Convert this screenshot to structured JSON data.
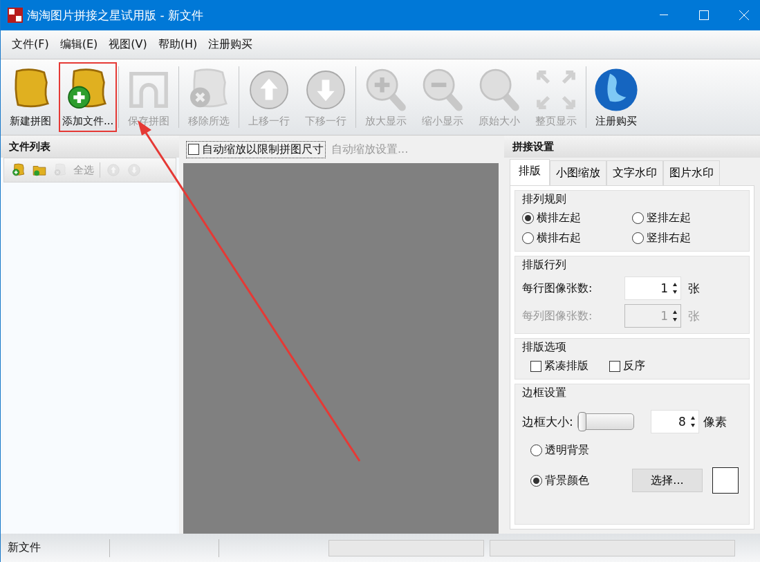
{
  "window": {
    "title": "淘淘图片拼接之星试用版 - 新文件"
  },
  "menu": [
    "文件(F)",
    "编辑(E)",
    "视图(V)",
    "帮助(H)",
    "注册购买"
  ],
  "toolbar_groups": [
    [
      {
        "kind": "new",
        "label": "新建拼图",
        "disabled": false,
        "highlighted": false
      },
      {
        "kind": "add",
        "label": "添加文件...",
        "disabled": false,
        "highlighted": true
      }
    ],
    [
      {
        "kind": "save",
        "label": "保存拼图",
        "disabled": true,
        "highlighted": false
      }
    ],
    [
      {
        "kind": "remove",
        "label": "移除所选",
        "disabled": true,
        "highlighted": false
      }
    ],
    [
      {
        "kind": "up",
        "label": "上移一行",
        "disabled": true,
        "highlighted": false
      },
      {
        "kind": "down",
        "label": "下移一行",
        "disabled": true,
        "highlighted": false
      }
    ],
    [
      {
        "kind": "zoomin",
        "label": "放大显示",
        "disabled": true,
        "highlighted": false
      },
      {
        "kind": "zoomout",
        "label": "缩小显示",
        "disabled": true,
        "highlighted": false
      },
      {
        "kind": "original",
        "label": "原始大小",
        "disabled": true,
        "highlighted": false
      },
      {
        "kind": "fit",
        "label": "整页显示",
        "disabled": true,
        "highlighted": false
      }
    ],
    [
      {
        "kind": "globe",
        "label": "注册购买",
        "disabled": false,
        "highlighted": false
      }
    ]
  ],
  "file_list": {
    "title": "文件列表",
    "tools": [
      {
        "kind": "add",
        "disabled": false
      },
      {
        "kind": "folder",
        "disabled": false
      },
      {
        "kind": "remove",
        "disabled": true
      },
      {
        "kind": "text",
        "label": "全选",
        "disabled": true
      },
      {
        "kind": "separator"
      },
      {
        "kind": "up",
        "disabled": true
      },
      {
        "kind": "down",
        "disabled": true
      }
    ]
  },
  "canvas": {
    "auto_scale": {
      "label": "自动缩放以限制拼图尺寸",
      "checked": false
    },
    "settings_link": "自动缩放设置..."
  },
  "settings": {
    "title": "拼接设置",
    "tabs": [
      {
        "label": "排版",
        "selected": true
      },
      {
        "label": "小图缩放",
        "selected": false
      },
      {
        "label": "文字水印",
        "selected": false
      },
      {
        "label": "图片水印",
        "selected": false
      }
    ],
    "arrangement": {
      "title": "排列规则",
      "options": [
        {
          "label": "横排左起",
          "selected": true
        },
        {
          "label": "竖排左起",
          "selected": false
        },
        {
          "label": "横排右起",
          "selected": false
        },
        {
          "label": "竖排右起",
          "selected": false
        }
      ]
    },
    "grid": {
      "title": "排版行列",
      "rows": [
        {
          "label": "每行图像张数:",
          "value": "1",
          "unit": "张",
          "disabled": false
        },
        {
          "label": "每列图像张数:",
          "value": "1",
          "unit": "张",
          "disabled": true
        }
      ]
    },
    "options": {
      "title": "排版选项",
      "checkboxes": [
        {
          "label": "紧凑排版",
          "checked": false
        },
        {
          "label": "反序",
          "checked": false
        }
      ]
    },
    "border": {
      "title": "边框设置",
      "size_label": "边框大小:",
      "level": 0.0,
      "value": "8",
      "unit": "像素",
      "backgrounds": [
        {
          "label": "透明背景",
          "selected": false
        },
        {
          "label": "背景颜色",
          "selected": true
        }
      ],
      "choose_button": "选择...",
      "color": "#ffffff"
    }
  },
  "status_bar": [
    "新文件"
  ],
  "annotation": {
    "arrow": true
  }
}
